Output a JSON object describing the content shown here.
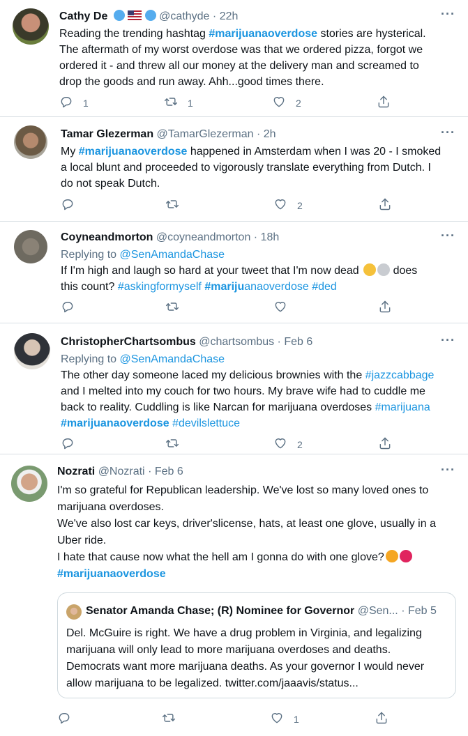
{
  "tweets": [
    {
      "name": "Cathy De",
      "handle": "@cathyde",
      "time": "22h",
      "text": [
        [
          {
            "t": "Reading the trending hashtag "
          },
          {
            "t": "#marijuanaoverdose",
            "tag": true,
            "bold": true
          },
          {
            "t": " stories are hysterical."
          }
        ],
        [
          {
            "t": "The aftermath of my worst overdose was that we ordered pizza, forgot we"
          }
        ],
        [
          {
            "t": "ordered it - and threw all our money at the delivery man and screamed to"
          }
        ],
        [
          {
            "t": "drop the goods and run away. Ahh...good times there."
          }
        ]
      ],
      "replies": "1",
      "retweets": "1",
      "likes": "2"
    },
    {
      "name": "Tamar Glezerman",
      "handle": "@TamarGlezerman",
      "time": "2h",
      "text": [
        [
          {
            "t": "My "
          },
          {
            "t": "#marijuanaoverdose",
            "tag": true,
            "bold": true
          },
          {
            "t": " happened in Amsterdam when I was 20 - I smoked"
          }
        ],
        [
          {
            "t": "a local blunt and proceeded to vigorously translate everything from Dutch. I"
          }
        ],
        [
          {
            "t": "do not speak Dutch."
          }
        ]
      ],
      "replies": "",
      "retweets": "",
      "likes": "2"
    },
    {
      "name": "Coyneandmorton",
      "handle": "@coyneandmorton",
      "time": "18h",
      "replying_label": "Replying to ",
      "replying_to": "@SenAmandaChase",
      "text": [
        [
          {
            "t": "If I'm high and laugh so hard at your tweet that I'm now dead "
          },
          {
            "t": "🤣",
            "emoji": "#f5c13a"
          },
          {
            "t": "💀",
            "emoji": "#c9ccd1"
          },
          {
            "t": " does"
          }
        ],
        [
          {
            "t": "this count? "
          },
          {
            "t": "#askingformyself",
            "tag": true
          },
          {
            "t": " "
          },
          {
            "t": "#mariju",
            "tag": true,
            "bold": true
          },
          {
            "t": "anaoverdose",
            "tag": true
          },
          {
            "t": " "
          },
          {
            "t": "#ded",
            "tag": true
          }
        ]
      ],
      "replies": "",
      "retweets": "",
      "likes": ""
    },
    {
      "name": "ChristopherChartsombus",
      "handle": "@chartsombus",
      "time": "Feb 6",
      "replying_label": "Replying to ",
      "replying_to": "@SenAmandaChase",
      "text": [
        [
          {
            "t": "The other day someone laced my delicious brownies with the "
          },
          {
            "t": "#jazzcabbage",
            "tag": true
          }
        ],
        [
          {
            "t": "and I melted into my couch for two hours. My brave wife had to cuddle me"
          }
        ],
        [
          {
            "t": "back to reality. Cuddling is like Narcan for marijuana overdoses "
          },
          {
            "t": "#marijuana",
            "tag": true
          }
        ],
        [
          {
            "t": "#marijuanaoverdose",
            "tag": true,
            "bold": true
          },
          {
            "t": " "
          },
          {
            "t": "#devilslettuce",
            "tag": true
          }
        ]
      ],
      "replies": "",
      "retweets": "",
      "likes": "2"
    },
    {
      "name": "Nozrati",
      "handle": "@Nozrati",
      "time": "Feb 6",
      "text": [
        [
          {
            "t": "I'm so grateful for Republican leadership. We've lost so many loved ones to"
          }
        ],
        [
          {
            "t": "marijuana overdoses."
          }
        ],
        [
          {
            "t": "We've also lost car keys, driver'slicense, hats, at least one glove, usually in a"
          }
        ],
        [
          {
            "t": "Uber ride."
          }
        ],
        [
          {
            "t": "I hate that cause now what the hell am I gonna do with one glove?"
          },
          {
            "t": "🤯",
            "emoji": "#f5a623"
          },
          {
            "t": "😡",
            "emoji": "#e0245e"
          }
        ],
        [
          {
            "t": "#marijuanaoverdose",
            "tag": true,
            "bold": true
          }
        ]
      ],
      "quote": {
        "name": "Senator Amanda Chase; (R) Nominee for Governor",
        "handle": "@Sen...",
        "time": "Feb 5",
        "text": [
          "Del. McGuire is right. We have a drug problem in Virginia, and legalizing",
          "marijuana will only lead to more marijuana overdoses and deaths.",
          "Democrats want more marijuana deaths. As your governor I would never",
          "allow marijuana to be legalized. twitter.com/jaaavis/status..."
        ]
      },
      "replies": "",
      "retweets": "",
      "likes": "1"
    }
  ],
  "icons": {
    "reply": "reply-icon",
    "retweet": "retweet-icon",
    "like": "heart-icon",
    "share": "share-icon",
    "more": "more-icon"
  },
  "colors": {
    "hashtag": "#1b95e0",
    "secondary": "#5b7083",
    "divider": "#d8dfe4"
  }
}
